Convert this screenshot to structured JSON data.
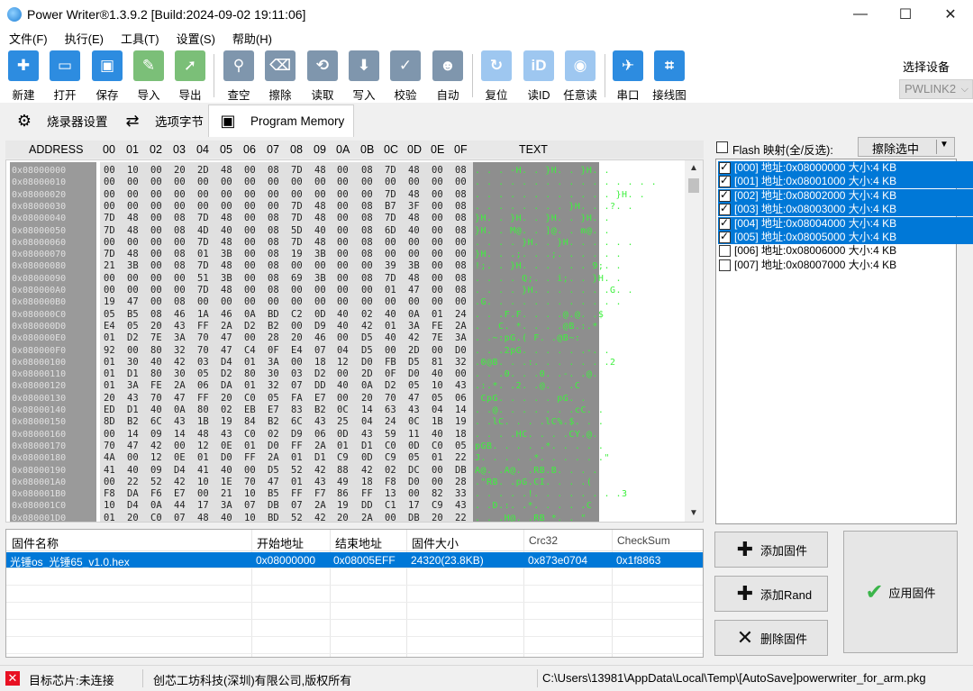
{
  "window": {
    "title": "Power Writer®1.3.9.2 [Build:2024-09-02 19:11:06]",
    "minimize": "—",
    "maximize": "☐",
    "close": "✕"
  },
  "menu": [
    "文件(F)",
    "执行(E)",
    "工具(T)",
    "设置(S)",
    "帮助(H)"
  ],
  "toolbar": {
    "buttons": [
      {
        "label": "新建",
        "glyph": "✚"
      },
      {
        "label": "打开",
        "glyph": "▭"
      },
      {
        "label": "保存",
        "glyph": "▣"
      },
      {
        "label": "导入",
        "glyph": "✎"
      },
      {
        "label": "导出",
        "glyph": "➚"
      },
      {
        "label": "查空",
        "glyph": "⚲"
      },
      {
        "label": "擦除",
        "glyph": "⌫"
      },
      {
        "label": "读取",
        "glyph": "⟲"
      },
      {
        "label": "写入",
        "glyph": "⬇"
      },
      {
        "label": "校验",
        "glyph": "✓"
      },
      {
        "label": "自动",
        "glyph": "☻"
      },
      {
        "label": "复位",
        "glyph": "↻"
      },
      {
        "label": "读ID",
        "glyph": "iD"
      },
      {
        "label": "任意读",
        "glyph": "◉"
      },
      {
        "label": "串口",
        "glyph": "✈"
      },
      {
        "label": "接线图",
        "glyph": "⌗"
      }
    ],
    "device_label": "选择设备",
    "device_value": "PWLINK2"
  },
  "tabs": [
    {
      "label": "烧录器设置",
      "glyph": "⚙"
    },
    {
      "label": "选项字节",
      "glyph": "⇄"
    },
    {
      "label": "Program Memory",
      "glyph": "▣"
    }
  ],
  "hex": {
    "header": {
      "address": "ADDRESS",
      "cols": [
        "00",
        "01",
        "02",
        "03",
        "04",
        "05",
        "06",
        "07",
        "08",
        "09",
        "0A",
        "0B",
        "0C",
        "0D",
        "0E",
        "0F"
      ],
      "text": "TEXT"
    },
    "rows": [
      {
        "addr": "0x08000000",
        "bytes": [
          "00",
          "10",
          "00",
          "20",
          "2D",
          "48",
          "00",
          "08",
          "7D",
          "48",
          "00",
          "08",
          "7D",
          "48",
          "00",
          "08"
        ],
        "text": ". . . -H. . }H. . }H. ."
      },
      {
        "addr": "0x08000010",
        "bytes": [
          "00",
          "00",
          "00",
          "00",
          "00",
          "00",
          "00",
          "00",
          "00",
          "00",
          "00",
          "00",
          "00",
          "00",
          "00",
          "00"
        ],
        "text": ". . . . . . . . . . . . . . . ."
      },
      {
        "addr": "0x08000020",
        "bytes": [
          "00",
          "00",
          "00",
          "00",
          "00",
          "00",
          "00",
          "00",
          "00",
          "00",
          "00",
          "00",
          "7D",
          "48",
          "00",
          "08"
        ],
        "text": ". . . . . . . . . . . . }H. ."
      },
      {
        "addr": "0x08000030",
        "bytes": [
          "00",
          "00",
          "00",
          "00",
          "00",
          "00",
          "00",
          "00",
          "7D",
          "48",
          "00",
          "08",
          "B7",
          "3F",
          "00",
          "08"
        ],
        "text": ". . . . . . . . }H. . .?. ."
      },
      {
        "addr": "0x08000040",
        "bytes": [
          "7D",
          "48",
          "00",
          "08",
          "7D",
          "48",
          "00",
          "08",
          "7D",
          "48",
          "00",
          "08",
          "7D",
          "48",
          "00",
          "08"
        ],
        "text": "}H. . }H. . }H. . }H. ."
      },
      {
        "addr": "0x08000050",
        "bytes": [
          "7D",
          "48",
          "00",
          "08",
          "4D",
          "40",
          "00",
          "08",
          "5D",
          "40",
          "00",
          "08",
          "6D",
          "40",
          "00",
          "08"
        ],
        "text": "}H. . M@. . ]@. . m@. ."
      },
      {
        "addr": "0x08000060",
        "bytes": [
          "00",
          "00",
          "00",
          "00",
          "7D",
          "48",
          "00",
          "08",
          "7D",
          "48",
          "00",
          "08",
          "00",
          "00",
          "00",
          "00"
        ],
        "text": ". . . . }H. . }H. . . . . ."
      },
      {
        "addr": "0x08000070",
        "bytes": [
          "7D",
          "48",
          "00",
          "08",
          "01",
          "3B",
          "00",
          "08",
          "19",
          "3B",
          "00",
          "08",
          "00",
          "00",
          "00",
          "00"
        ],
        "text": "}H. . .;. . .;. . . . . ."
      },
      {
        "addr": "0x08000080",
        "bytes": [
          "21",
          "3B",
          "00",
          "08",
          "7D",
          "48",
          "00",
          "08",
          "00",
          "00",
          "00",
          "00",
          "39",
          "3B",
          "00",
          "08"
        ],
        "text": "!;. . }H. . . . . . 9;. ."
      },
      {
        "addr": "0x08000090",
        "bytes": [
          "00",
          "00",
          "00",
          "00",
          "51",
          "3B",
          "00",
          "08",
          "69",
          "3B",
          "00",
          "08",
          "7D",
          "48",
          "00",
          "08"
        ],
        "text": ". . . . Q;. . i;. . }H. ."
      },
      {
        "addr": "0x080000A0",
        "bytes": [
          "00",
          "00",
          "00",
          "00",
          "7D",
          "48",
          "00",
          "08",
          "00",
          "00",
          "00",
          "00",
          "01",
          "47",
          "00",
          "08"
        ],
        "text": ". . . . }H. . . . . . .G. ."
      },
      {
        "addr": "0x080000B0",
        "bytes": [
          "19",
          "47",
          "00",
          "08",
          "00",
          "00",
          "00",
          "00",
          "00",
          "00",
          "00",
          "00",
          "00",
          "00",
          "00",
          "00"
        ],
        "text": ".G. . . . . . . . . . . ."
      },
      {
        "addr": "0x080000C0",
        "bytes": [
          "05",
          "B5",
          "08",
          "46",
          "1A",
          "46",
          "0A",
          "BD",
          "C2",
          "0D",
          "40",
          "02",
          "40",
          "0A",
          "01",
          "24"
        ],
        "text": ". . .F.F. . . .@.@. .$"
      },
      {
        "addr": "0x080000D0",
        "bytes": [
          "E4",
          "05",
          "20",
          "43",
          "FF",
          "2A",
          "D2",
          "B2",
          "00",
          "D9",
          "40",
          "42",
          "01",
          "3A",
          "FE",
          "2A"
        ],
        "text": ". . C. *. . . .@B.:.*"
      },
      {
        "addr": "0x080000E0",
        "bytes": [
          "01",
          "D2",
          "7E",
          "3A",
          "70",
          "47",
          "00",
          "28",
          "20",
          "46",
          "00",
          "D5",
          "40",
          "42",
          "7E",
          "3A"
        ],
        "text": ". .~:pG.( F. .@B~:"
      },
      {
        "addr": "0x080000F0",
        "bytes": [
          "92",
          "00",
          "80",
          "32",
          "70",
          "47",
          "C4",
          "0F",
          "E4",
          "07",
          "04",
          "D5",
          "00",
          "2D",
          "00",
          "D0"
        ],
        "text": ". . .2pG. . . . . .-. ."
      },
      {
        "addr": "0x08000100",
        "bytes": [
          "01",
          "30",
          "40",
          "42",
          "03",
          "D4",
          "01",
          "3A",
          "00",
          "18",
          "12",
          "D0",
          "FB",
          "D5",
          "81",
          "32"
        ],
        "text": ".0@B. . .:. . . . . . .2"
      },
      {
        "addr": "0x08000110",
        "bytes": [
          "01",
          "D1",
          "80",
          "30",
          "05",
          "D2",
          "80",
          "30",
          "03",
          "D2",
          "00",
          "2D",
          "0F",
          "D0",
          "40",
          "00"
        ],
        "text": ". . .0. . .0. .-. .@."
      },
      {
        "addr": "0x08000120",
        "bytes": [
          "01",
          "3A",
          "FE",
          "2A",
          "06",
          "DA",
          "01",
          "32",
          "07",
          "DD",
          "40",
          "0A",
          "D2",
          "05",
          "10",
          "43"
        ],
        "text": ".:.*. .2. .@. . .C"
      },
      {
        "addr": "0x08000130",
        "bytes": [
          "20",
          "43",
          "70",
          "47",
          "FF",
          "20",
          "C0",
          "05",
          "FA",
          "E7",
          "00",
          "20",
          "70",
          "47",
          "05",
          "06"
        ],
        "text": " CpG. . . . . pG. ."
      },
      {
        "addr": "0x08000140",
        "bytes": [
          "ED",
          "D1",
          "40",
          "0A",
          "80",
          "02",
          "EB",
          "E7",
          "83",
          "B2",
          "0C",
          "14",
          "63",
          "43",
          "04",
          "14"
        ],
        "text": ". .@. . . . . . .cC. ."
      },
      {
        "addr": "0x08000150",
        "bytes": [
          "8D",
          "B2",
          "6C",
          "43",
          "1B",
          "19",
          "84",
          "B2",
          "6C",
          "43",
          "25",
          "04",
          "24",
          "0C",
          "1B",
          "19"
        ],
        "text": ". .lC. . . .lC%.$. . ."
      },
      {
        "addr": "0x08000160",
        "bytes": [
          "00",
          "14",
          "09",
          "14",
          "48",
          "43",
          "C0",
          "02",
          "D9",
          "06",
          "0D",
          "43",
          "59",
          "11",
          "40",
          "18"
        ],
        "text": ". . . .HC. . . .CY.@."
      },
      {
        "addr": "0x08000170",
        "bytes": [
          "70",
          "47",
          "42",
          "00",
          "12",
          "0E",
          "01",
          "D0",
          "FF",
          "2A",
          "01",
          "D1",
          "C0",
          "0D",
          "C0",
          "05"
        ],
        "text": "pGB. . . . .*. . . . ."
      },
      {
        "addr": "0x08000180",
        "bytes": [
          "4A",
          "00",
          "12",
          "0E",
          "01",
          "D0",
          "FF",
          "2A",
          "01",
          "D1",
          "C9",
          "0D",
          "C9",
          "05",
          "01",
          "22"
        ],
        "text": "J. . . . .*. . . . . .\""
      },
      {
        "addr": "0x08000190",
        "bytes": [
          "41",
          "40",
          "09",
          "D4",
          "41",
          "40",
          "00",
          "D5",
          "52",
          "42",
          "88",
          "42",
          "02",
          "DC",
          "00",
          "DB"
        ],
        "text": "A@. .A@. .RB.B. . . ."
      },
      {
        "addr": "0x080001A0",
        "bytes": [
          "00",
          "22",
          "52",
          "42",
          "10",
          "1E",
          "70",
          "47",
          "01",
          "43",
          "49",
          "18",
          "F8",
          "D0",
          "00",
          "28"
        ],
        "text": ".\"RB. .pG.CI. . . .("
      },
      {
        "addr": "0x080001B0",
        "bytes": [
          "F8",
          "DA",
          "F6",
          "E7",
          "00",
          "21",
          "10",
          "B5",
          "FF",
          "F7",
          "86",
          "FF",
          "13",
          "00",
          "82",
          "33"
        ],
        "text": ". . . . .!. . . . . . . .3"
      },
      {
        "addr": "0x080001C0",
        "bytes": [
          "10",
          "D4",
          "0A",
          "44",
          "17",
          "3A",
          "07",
          "DB",
          "07",
          "2A",
          "19",
          "DD",
          "C1",
          "17",
          "C9",
          "43"
        ],
        "text": ". .D.:. .*. . . . .C"
      },
      {
        "addr": "0x080001D0",
        "bytes": [
          "01",
          "20",
          "C0",
          "07",
          "48",
          "40",
          "10",
          "BD",
          "52",
          "42",
          "20",
          "2A",
          "00",
          "DB",
          "20",
          "22"
        ],
        "text": ". . .H@. .RB *. . \""
      }
    ]
  },
  "flash": {
    "header_label": "Flash 映射(全/反选):",
    "erase_label": "擦除选中",
    "dropdown_glyph": "▼",
    "items": [
      {
        "text": "[000] 地址:0x08000000 大小:4 KB",
        "checked": true,
        "selected": true
      },
      {
        "text": "[001] 地址:0x08001000 大小:4 KB",
        "checked": true,
        "selected": true
      },
      {
        "text": "[002] 地址:0x08002000 大小:4 KB",
        "checked": true,
        "selected": true
      },
      {
        "text": "[003] 地址:0x08003000 大小:4 KB",
        "checked": true,
        "selected": true
      },
      {
        "text": "[004] 地址:0x08004000 大小:4 KB",
        "checked": true,
        "selected": true
      },
      {
        "text": "[005] 地址:0x08005000 大小:4 KB",
        "checked": true,
        "selected": true
      },
      {
        "text": "[006] 地址:0x08006000 大小:4 KB",
        "checked": false,
        "selected": false
      },
      {
        "text": "[007] 地址:0x08007000 大小:4 KB",
        "checked": false,
        "selected": false
      }
    ]
  },
  "firmware": {
    "columns": [
      "固件名称",
      "开始地址",
      "结束地址",
      "固件大小",
      "Crc32",
      "CheckSum"
    ],
    "rows": [
      [
        "光锤os_光锤65_v1.0.hex",
        "0x08000000",
        "0x08005EFF",
        "24320(23.8KB)",
        "0x873e0704",
        "0x1f8863"
      ]
    ]
  },
  "actions": {
    "add_fw": "添加固件",
    "add_rand": "添加Rand",
    "del_fw": "删除固件",
    "apply_fw": "应用固件",
    "plus_glyph": "✚",
    "x_glyph": "✕",
    "check_glyph": "✔"
  },
  "status": {
    "error_glyph": "✕",
    "chip": "目标芯片:未连接",
    "company": "创芯工坊科技(深圳)有限公司,版权所有",
    "path": "C:\\Users\\13981\\AppData\\Local\\Temp\\[AutoSave]powerwriter_for_arm.pkg"
  },
  "colors": {
    "selection": "#0078d7",
    "hex_text_green": "#3ef03e",
    "apply_check": "#3bb54a",
    "error_red": "#e81123"
  }
}
